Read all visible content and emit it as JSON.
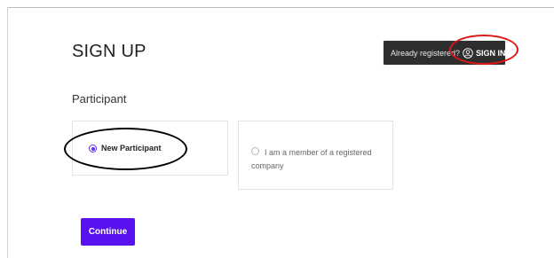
{
  "header": {
    "title": "SIGN UP",
    "signin_prompt": "Already registered?",
    "signin_label": "SIGN IN",
    "signin_icon": "user-circle-icon"
  },
  "form": {
    "section_label": "Participant",
    "options": [
      {
        "label": "New Participant",
        "selected": true
      },
      {
        "label": "I am a member of a registered company",
        "selected": false
      }
    ],
    "continue_label": "Continue"
  },
  "colors": {
    "accent": "#5a11f0",
    "signin_bg": "#2e2e2e",
    "annotation_red": "#e01616",
    "annotation_black": "#000000"
  }
}
